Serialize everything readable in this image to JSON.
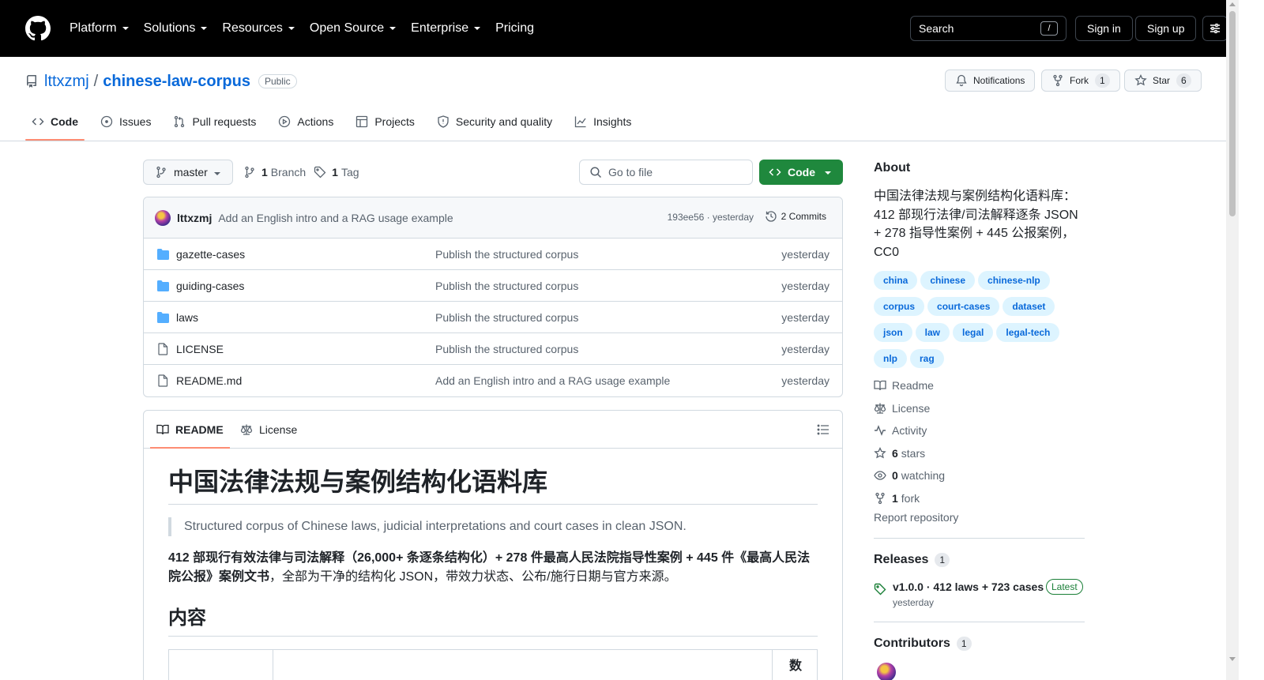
{
  "header": {
    "nav": [
      {
        "label": "Platform",
        "has_caret": true
      },
      {
        "label": "Solutions",
        "has_caret": true
      },
      {
        "label": "Resources",
        "has_caret": true
      },
      {
        "label": "Open Source",
        "has_caret": true
      },
      {
        "label": "Enterprise",
        "has_caret": true
      },
      {
        "label": "Pricing",
        "has_caret": false
      }
    ],
    "search_label": "Search",
    "search_shortcut": "/",
    "sign_in": "Sign in",
    "sign_up": "Sign up"
  },
  "repo": {
    "owner": "lttxzmj",
    "separator": "/",
    "name": "chinese-law-corpus",
    "visibility": "Public",
    "notifications_label": "Notifications",
    "fork_label": "Fork",
    "fork_count": "1",
    "star_label": "Star",
    "star_count": "6"
  },
  "tabs": [
    {
      "label": "Code",
      "icon": "code-icon"
    },
    {
      "label": "Issues",
      "icon": "issue-icon"
    },
    {
      "label": "Pull requests",
      "icon": "pull-request-icon"
    },
    {
      "label": "Actions",
      "icon": "play-icon"
    },
    {
      "label": "Projects",
      "icon": "table-icon"
    },
    {
      "label": "Security and quality",
      "icon": "shield-icon"
    },
    {
      "label": "Insights",
      "icon": "graph-icon"
    }
  ],
  "filebar": {
    "branch": "master",
    "branch_count": "1",
    "branch_label": "Branch",
    "tag_count": "1",
    "tag_label": "Tag",
    "go_to_file": "Go to file",
    "code_button": "Code"
  },
  "latest_commit": {
    "author": "lttxzmj",
    "message": "Add an English intro and a RAG usage example",
    "meta": "193ee56 · yesterday",
    "commits_label": "2 Commits"
  },
  "files": [
    {
      "name": "gazette-cases",
      "type": "folder",
      "commit": "Publish the structured corpus",
      "date": "yesterday"
    },
    {
      "name": "guiding-cases",
      "type": "folder",
      "commit": "Publish the structured corpus",
      "date": "yesterday"
    },
    {
      "name": "laws",
      "type": "folder",
      "commit": "Publish the structured corpus",
      "date": "yesterday"
    },
    {
      "name": "LICENSE",
      "type": "file",
      "commit": "Publish the structured corpus",
      "date": "yesterday"
    },
    {
      "name": "README.md",
      "type": "file",
      "commit": "Add an English intro and a RAG usage example",
      "date": "yesterday"
    }
  ],
  "readme": {
    "tab_readme": "README",
    "tab_license": "License",
    "h1": "中国法律法规与案例结构化语料库",
    "quote": "Structured corpus of Chinese laws, judicial interpretations and court cases in clean JSON.",
    "p_bold": "412 部现行有效法律与司法解释（26,000+ 条逐条结构化）+ 278 件最高人民法院指导性案例 + 445 件《最高人民法院公报》案例文书",
    "p_rest": "，全部为干净的结构化 JSON，带效力状态、公布/施行日期与官方来源。",
    "h2": "内容",
    "table_header_cut": "数"
  },
  "about": {
    "heading": "About",
    "description": "中国法律法规与案例结构化语料库：412 部现行法律/司法解释逐条 JSON + 278 指导性案例 + 445 公报案例，CC0",
    "topics": [
      "china",
      "chinese",
      "chinese-nlp",
      "corpus",
      "court-cases",
      "dataset",
      "json",
      "law",
      "legal",
      "legal-tech",
      "nlp",
      "rag"
    ],
    "links": [
      {
        "icon": "book-icon",
        "num": "",
        "label": "Readme"
      },
      {
        "icon": "law-icon",
        "num": "",
        "label": "License"
      },
      {
        "icon": "pulse-icon",
        "num": "",
        "label": "Activity"
      },
      {
        "icon": "star-icon",
        "num": "6",
        "label": "stars"
      },
      {
        "icon": "eye-icon",
        "num": "0",
        "label": "watching"
      },
      {
        "icon": "fork-icon",
        "num": "1",
        "label": "fork"
      }
    ],
    "report": "Report repository"
  },
  "releases": {
    "heading": "Releases",
    "count": "1",
    "name": "v1.0.0 · 412 laws + 723 cases",
    "latest": "Latest",
    "date": "yesterday"
  },
  "contributors": {
    "heading": "Contributors",
    "count": "1"
  },
  "colors": {
    "header_bg": "#000000",
    "link": "#0969da",
    "code_button": "#1f883d",
    "tab_underline": "#fd8c73",
    "topic_bg": "#ddf4ff",
    "latest_badge": "#1a7f37"
  }
}
